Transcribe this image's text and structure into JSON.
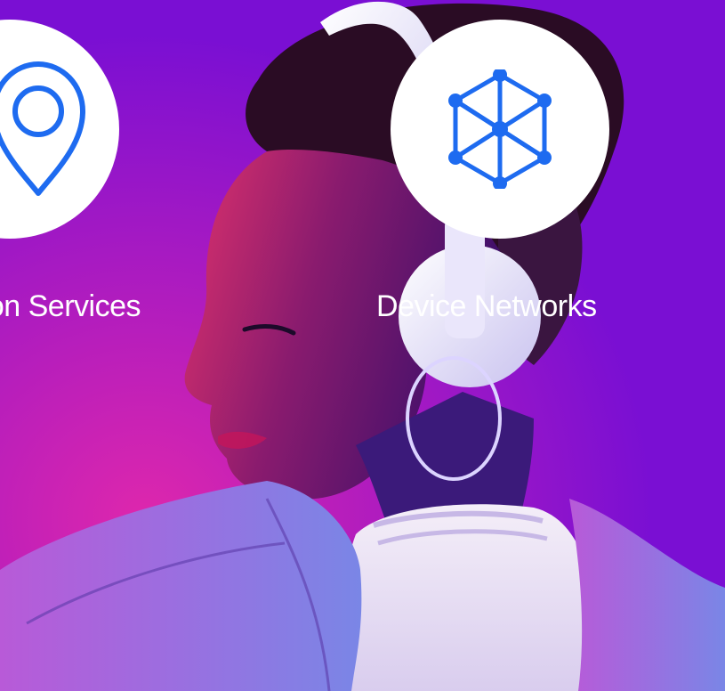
{
  "features": [
    {
      "label": "Location Services",
      "icon": "location-pin-icon"
    },
    {
      "label": "Device Networks",
      "icon": "cube-network-icon"
    }
  ],
  "colors": {
    "background": "#7a0fd3",
    "icon_blue": "#1e6bf0",
    "circle": "#ffffff",
    "label_text": "#ffffff"
  }
}
